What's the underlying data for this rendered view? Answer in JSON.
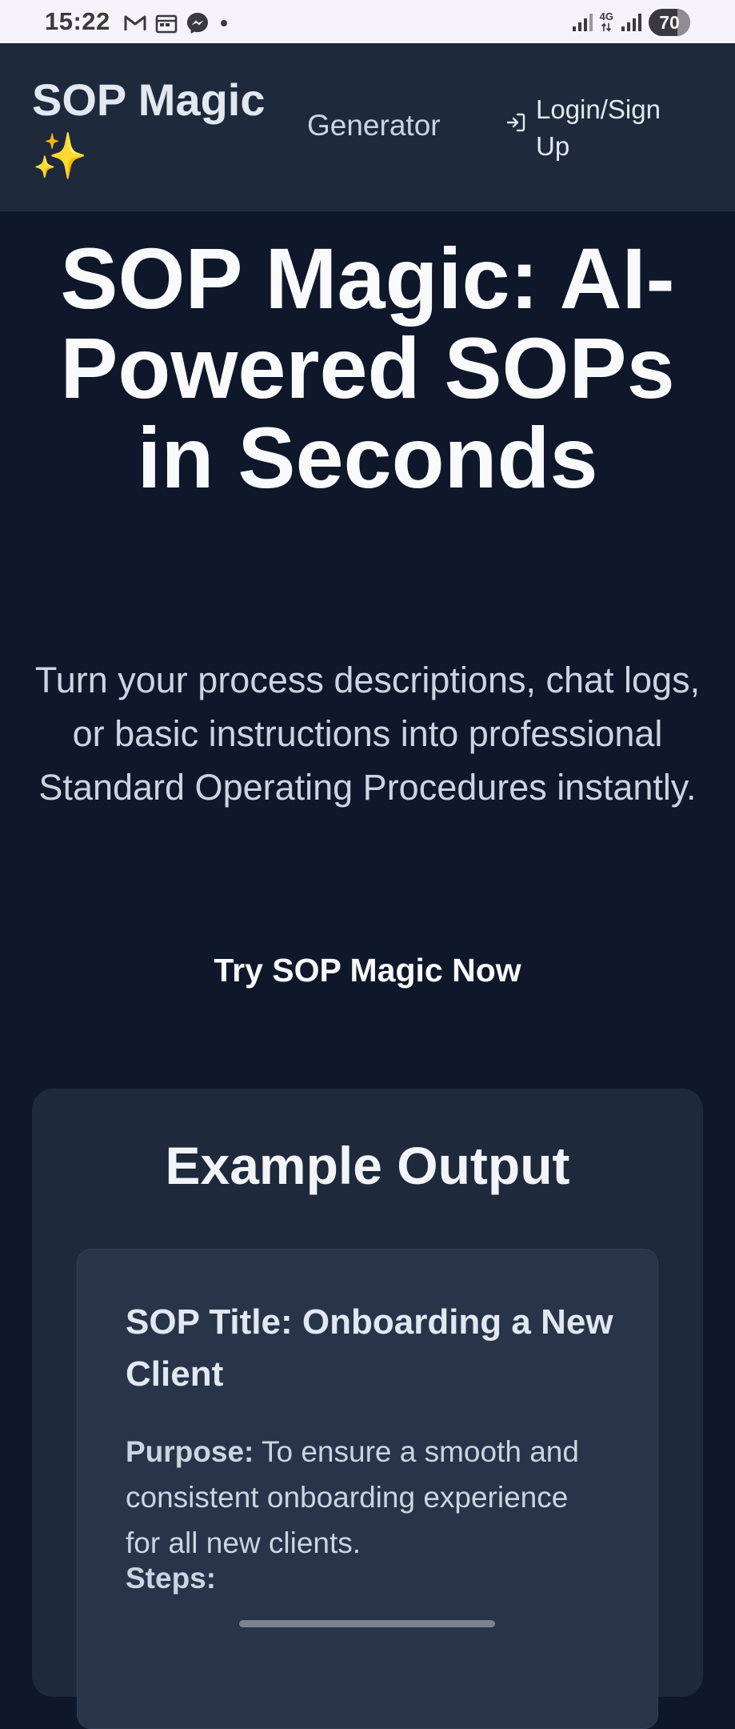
{
  "status_bar": {
    "time": "15:22",
    "network_label": "4G",
    "battery_level": "70",
    "left_icons": [
      "gmail-icon",
      "calendar-icon",
      "messenger-icon",
      "notification-dot-icon"
    ],
    "right_icons": [
      "signal-icon",
      "data-transfer-icon",
      "signal-icon",
      "battery-icon"
    ]
  },
  "navbar": {
    "brand": "SOP Magic ✨",
    "generator_link": "Generator",
    "login_icon": "login-arrow-icon",
    "login_link": "Login/Sign Up"
  },
  "hero": {
    "title": "SOP Magic: AI-Powered SOPs in Seconds",
    "subtitle": "Turn your process descriptions, chat logs, or basic instructions into professional Standard Operating Procedures instantly.",
    "cta_label": "Try SOP Magic Now"
  },
  "example": {
    "heading": "Example Output",
    "sop_title": "SOP Title: Onboarding a New Client",
    "purpose_label": "Purpose:",
    "purpose_text": "To ensure a smooth and consistent onboarding experience for all new clients.",
    "steps_label": "Steps:"
  },
  "colors": {
    "page_background": "#0f172a",
    "navbar_background": "#1e293b",
    "card_background": "#1e293b",
    "inner_card_background": "#273449",
    "status_bar_background": "#f6f4f8"
  }
}
